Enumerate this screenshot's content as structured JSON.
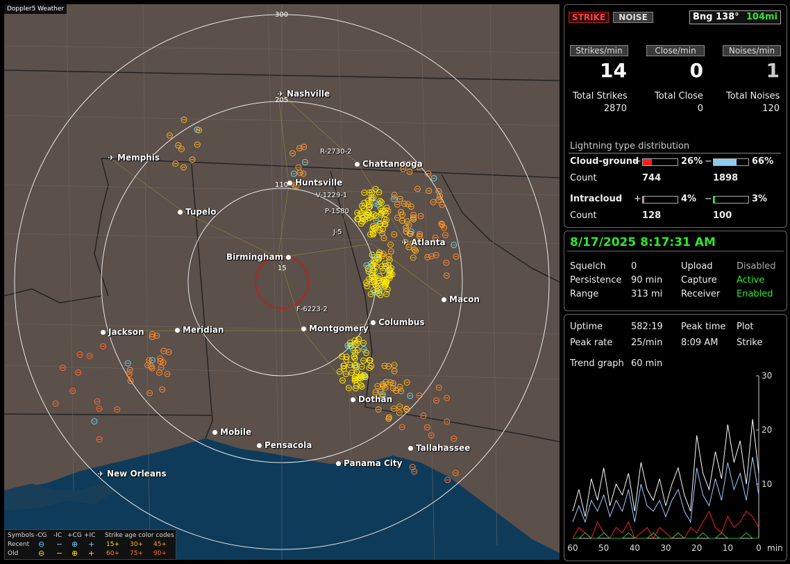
{
  "map": {
    "tag": "Doppler5 Weather",
    "ring_labels": [
      "300",
      "205",
      "110",
      "15"
    ],
    "cities": [
      {
        "name": "Nashville",
        "kind": "airport"
      },
      {
        "name": "Memphis",
        "kind": "airport"
      },
      {
        "name": "Chattanooga",
        "kind": "city"
      },
      {
        "name": "Huntsville",
        "kind": "city"
      },
      {
        "name": "Tupelo",
        "kind": "city"
      },
      {
        "name": "Atlanta",
        "kind": "airport"
      },
      {
        "name": "Birmingham",
        "kind": "city"
      },
      {
        "name": "Macon",
        "kind": "city"
      },
      {
        "name": "Jackson",
        "kind": "city"
      },
      {
        "name": "Meridian",
        "kind": "city"
      },
      {
        "name": "Montgomery",
        "kind": "city"
      },
      {
        "name": "Columbus",
        "kind": "city"
      },
      {
        "name": "Dothan",
        "kind": "city"
      },
      {
        "name": "Mobile",
        "kind": "city"
      },
      {
        "name": "Pensacola",
        "kind": "city"
      },
      {
        "name": "Tallahassee",
        "kind": "city"
      },
      {
        "name": "Panama City",
        "kind": "city"
      },
      {
        "name": "New Orleans",
        "kind": "airport"
      }
    ],
    "storms": [
      "R-2730-2",
      "V-1229-1",
      "P-1580",
      "J-5",
      "F-6223-2"
    ],
    "legend": {
      "symbols_label": "Symbols",
      "columns": [
        "-CG",
        "-IC",
        "+CG",
        "+IC"
      ],
      "age_title": "Strike age color codes",
      "recent_label": "Recent",
      "old_label": "Old",
      "recent_ages": [
        "15+",
        "30+",
        "45+"
      ],
      "old_ages": [
        "60+",
        "75+",
        "90+"
      ]
    }
  },
  "status": {
    "strike_btn": "STRIKE",
    "noise_btn": "NOISE",
    "bearing": "Bng 138°",
    "distance": "104mi",
    "strikes_per_min_label": "Strikes/min",
    "close_per_min_label": "Close/min",
    "noises_per_min_label": "Noises/min",
    "strikes_per_min": "14",
    "close_per_min": "0",
    "noises_per_min": "1",
    "total_strikes_label": "Total Strikes",
    "total_close_label": "Total Close",
    "total_noises_label": "Total Noises",
    "total_strikes": "2870",
    "total_close": "0",
    "total_noises": "120",
    "dist_title": "Lightning type distribution",
    "cg_label": "Cloud-ground",
    "ic_label": "Intracloud",
    "count_label": "Count",
    "plus": "+",
    "minus": "−",
    "cg_pos_pct": "26%",
    "cg_neg_pct": "66%",
    "cg_pos_count": "744",
    "cg_neg_count": "1898",
    "ic_pos_pct": "4%",
    "ic_neg_pct": "3%",
    "ic_pos_count": "128",
    "ic_neg_count": "100",
    "cg_pos_frac": 0.26,
    "cg_neg_frac": 0.66,
    "ic_pos_frac": 0.04,
    "ic_neg_frac": 0.03
  },
  "info": {
    "datetime": "8/17/2025 8:17:31 AM",
    "squelch_label": "Squelch",
    "squelch": "0",
    "persistence_label": "Persistence",
    "persistence": "90 min",
    "range_label": "Range",
    "range": "313 mi",
    "upload_label": "Upload",
    "upload": "Disabled",
    "capture_label": "Capture",
    "capture": "Active",
    "receiver_label": "Receiver",
    "receiver": "Enabled"
  },
  "trend": {
    "uptime_label": "Uptime",
    "uptime": "582:19",
    "peak_time_label": "Peak time",
    "peak_time": "8:09 AM",
    "plot_label": "Plot",
    "plot": "Strike",
    "peak_rate_label": "Peak rate",
    "peak_rate": "25/min",
    "trend_graph_label": "Trend graph",
    "trend_graph": "60 min",
    "x_ticks": [
      "60",
      "50",
      "40",
      "30",
      "20",
      "10",
      "0"
    ],
    "x_unit": "min",
    "y_ticks": [
      "30",
      "20",
      "10"
    ]
  },
  "chart_data": {
    "type": "line",
    "x": [
      60,
      58,
      56,
      54,
      52,
      50,
      48,
      46,
      44,
      42,
      40,
      38,
      36,
      34,
      32,
      30,
      28,
      26,
      24,
      22,
      20,
      18,
      16,
      14,
      12,
      10,
      8,
      6,
      4,
      2,
      0
    ],
    "xlim": [
      60,
      0
    ],
    "ylim": [
      0,
      30
    ],
    "series": [
      {
        "color": "#ffffff",
        "values": [
          5,
          9,
          4,
          11,
          7,
          13,
          6,
          10,
          8,
          12,
          5,
          14,
          9,
          7,
          11,
          6,
          10,
          13,
          8,
          5,
          19,
          12,
          9,
          16,
          11,
          21,
          14,
          18,
          10,
          22,
          12
        ]
      },
      {
        "color": "#9fd0ff",
        "values": [
          3,
          6,
          3,
          7,
          5,
          8,
          4,
          7,
          5,
          9,
          3,
          10,
          6,
          5,
          7,
          4,
          7,
          9,
          5,
          3,
          13,
          8,
          6,
          11,
          7,
          14,
          9,
          12,
          7,
          15,
          8
        ]
      },
      {
        "color": "#ff2020",
        "values": [
          0,
          2,
          1,
          0,
          3,
          1,
          0,
          2,
          1,
          3,
          0,
          1,
          2,
          0,
          2,
          1,
          0,
          1,
          0,
          2,
          1,
          3,
          5,
          2,
          1,
          4,
          2,
          3,
          5,
          4,
          2
        ]
      },
      {
        "color": "#22c022",
        "values": [
          0,
          0,
          1,
          0,
          0,
          1,
          0,
          0,
          0,
          1,
          0,
          0,
          0,
          1,
          0,
          0,
          0,
          1,
          0,
          0,
          0,
          1,
          0,
          0,
          1,
          0,
          0,
          0,
          1,
          0,
          0
        ]
      }
    ]
  }
}
